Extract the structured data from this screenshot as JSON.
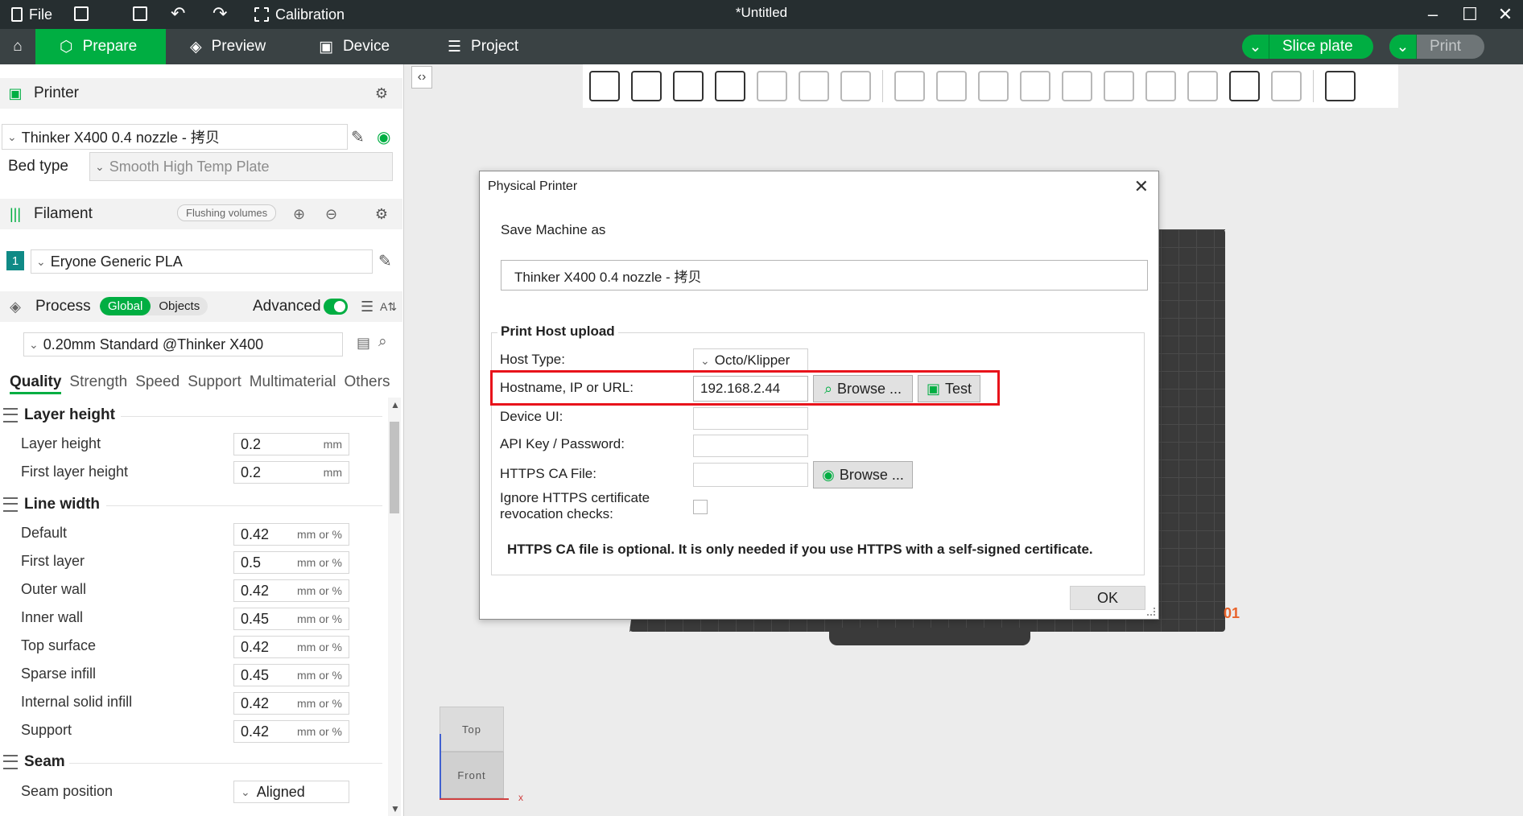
{
  "app": {
    "title": "*Untitled",
    "menu": {
      "file_label": "File",
      "calibration_label": "Calibration"
    }
  },
  "tabs": [
    {
      "label": "Prepare",
      "icon": "cube-icon"
    },
    {
      "label": "Preview",
      "icon": "layers-icon"
    },
    {
      "label": "Device",
      "icon": "device-icon"
    },
    {
      "label": "Project",
      "icon": "project-icon"
    }
  ],
  "actions": {
    "slice_label": "Slice plate",
    "print_label": "Print"
  },
  "colors": {
    "accent": "#00ae42",
    "titlebar": "#262e30",
    "tabbar": "#3a4244",
    "highlight": "#e8131b"
  },
  "printer": {
    "header": "Printer",
    "preset": "Thinker X400 0.4 nozzle - 拷贝",
    "bed_type_label": "Bed type",
    "bed_type_value": "Smooth High Temp Plate"
  },
  "filament": {
    "header": "Filament",
    "flushing_label": "Flushing volumes",
    "slot_number": "1",
    "preset": "Eryone Generic PLA"
  },
  "process": {
    "header": "Process",
    "global_label": "Global",
    "objects_label": "Objects",
    "advanced_label": "Advanced",
    "preset": "0.20mm Standard @Thinker X400"
  },
  "settings_tabs": [
    "Quality",
    "Strength",
    "Speed",
    "Support",
    "Multimaterial",
    "Others"
  ],
  "groups": {
    "layer_height": {
      "title": "Layer height",
      "rows": [
        {
          "label": "Layer height",
          "value": "0.2",
          "unit": "mm"
        },
        {
          "label": "First layer height",
          "value": "0.2",
          "unit": "mm"
        }
      ]
    },
    "line_width": {
      "title": "Line width",
      "rows": [
        {
          "label": "Default",
          "value": "0.42",
          "unit": "mm or %"
        },
        {
          "label": "First layer",
          "value": "0.5",
          "unit": "mm or %"
        },
        {
          "label": "Outer wall",
          "value": "0.42",
          "unit": "mm or %"
        },
        {
          "label": "Inner wall",
          "value": "0.45",
          "unit": "mm or %"
        },
        {
          "label": "Top surface",
          "value": "0.42",
          "unit": "mm or %"
        },
        {
          "label": "Sparse infill",
          "value": "0.45",
          "unit": "mm or %"
        },
        {
          "label": "Internal solid infill",
          "value": "0.42",
          "unit": "mm or %"
        },
        {
          "label": "Support",
          "value": "0.42",
          "unit": "mm or %"
        }
      ]
    },
    "seam": {
      "title": "Seam",
      "rows": [
        {
          "label": "Seam position",
          "value": "Aligned"
        }
      ]
    }
  },
  "viewcube": {
    "top_label": "Top",
    "front_label": "Front",
    "x_axis": "x"
  },
  "plate": {
    "number": "01"
  },
  "dialog": {
    "title": "Physical Printer",
    "save_as_label": "Save Machine as",
    "save_as_value": "Thinker X400 0.4 nozzle - 拷贝",
    "section_title": "Print Host upload",
    "host_type_label": "Host Type:",
    "host_type_value": "Octo/Klipper",
    "hostname_label": "Hostname, IP or URL:",
    "hostname_value": "192.168.2.44",
    "browse_label": "Browse ...",
    "test_label": "Test",
    "device_ui_label": "Device UI:",
    "api_key_label": "API Key / Password:",
    "https_ca_label": "HTTPS CA File:",
    "ignore_label_line1": "Ignore HTTPS certificate",
    "ignore_label_line2": "revocation checks:",
    "note": "HTTPS CA file is optional. It is only needed if you use HTTPS with a self-signed certificate.",
    "ok_label": "OK"
  }
}
